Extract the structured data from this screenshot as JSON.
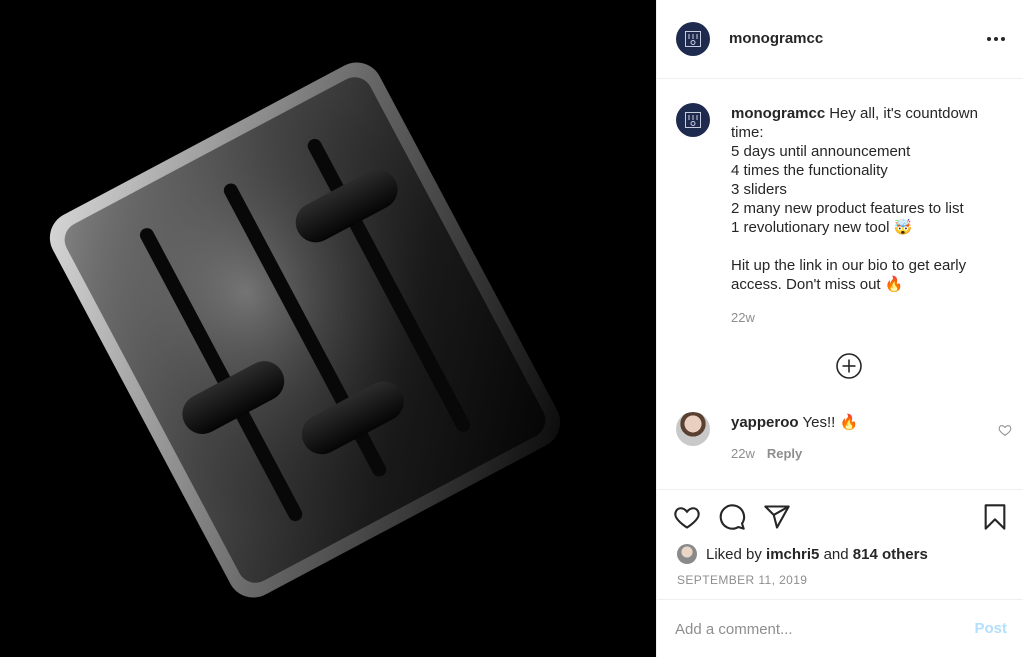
{
  "post": {
    "username": "monogramcc",
    "caption_lines": [
      "Hey all, it's countdown time:",
      "5 days until announcement",
      "4 times the functionality",
      "3 sliders",
      "2 many new product features to list",
      "1 revolutionary new tool 🤯",
      "",
      "Hit up the link in our bio to get early access. Don't miss out 🔥"
    ],
    "caption_time": "22w",
    "likes_prefix": "Liked by",
    "likes_user": "imchri5",
    "likes_conjunction": "and",
    "likes_others": "814 others",
    "date": "SEPTEMBER 11, 2019"
  },
  "comments": [
    {
      "username": "yapperoo",
      "text": "Yes!! 🔥",
      "time": "22w",
      "reply_label": "Reply"
    }
  ],
  "add_comment": {
    "placeholder": "Add a comment...",
    "post_label": "Post"
  },
  "colors": {
    "accent_disabled": "#b2dffc",
    "avatar_bg": "#1e2a4e",
    "text": "#262626",
    "muted": "#8e8e8e"
  },
  "icons": [
    "monogram-logo-icon",
    "more-options-icon",
    "load-more-comments-icon",
    "heart-icon",
    "comment-icon",
    "share-icon",
    "bookmark-icon",
    "comment-like-icon"
  ]
}
